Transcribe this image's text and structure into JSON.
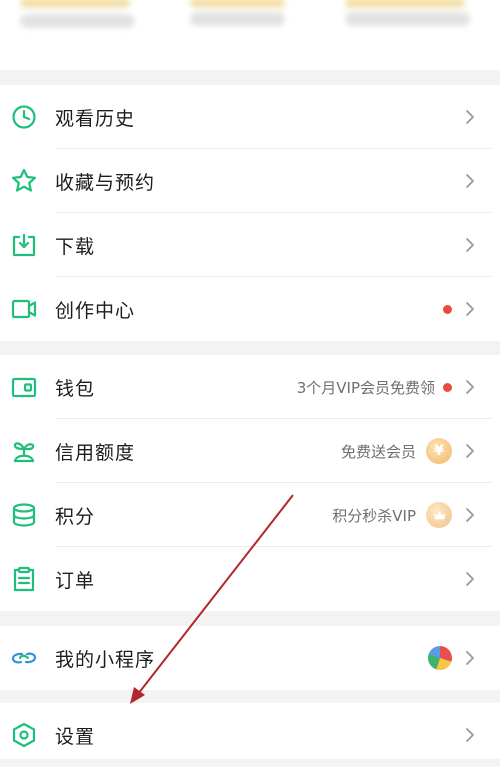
{
  "colors": {
    "accent": "#1dbf7a",
    "red_dot": "#ea4b3c",
    "annotation_arrow": "#b3262c"
  },
  "menu": {
    "history": {
      "label": "观看历史",
      "icon": "clock-icon"
    },
    "favorites": {
      "label": "收藏与预约",
      "icon": "star-icon"
    },
    "download": {
      "label": "下载",
      "icon": "download-icon"
    },
    "creator": {
      "label": "创作中心",
      "icon": "video-camera-icon"
    },
    "wallet": {
      "label": "钱包",
      "icon": "wallet-icon",
      "promo": "3个月VIP会员免费领"
    },
    "credit": {
      "label": "信用额度",
      "icon": "sprout-icon",
      "promo": "免费送会员",
      "badge_glyph": "¥"
    },
    "points": {
      "label": "积分",
      "icon": "database-icon",
      "promo": "积分秒杀VIP"
    },
    "orders": {
      "label": "订单",
      "icon": "clipboard-icon"
    },
    "miniprogram": {
      "label": "我的小程序",
      "icon": "link-icon"
    },
    "settings": {
      "label": "设置",
      "icon": "hexagon-settings-icon"
    }
  }
}
